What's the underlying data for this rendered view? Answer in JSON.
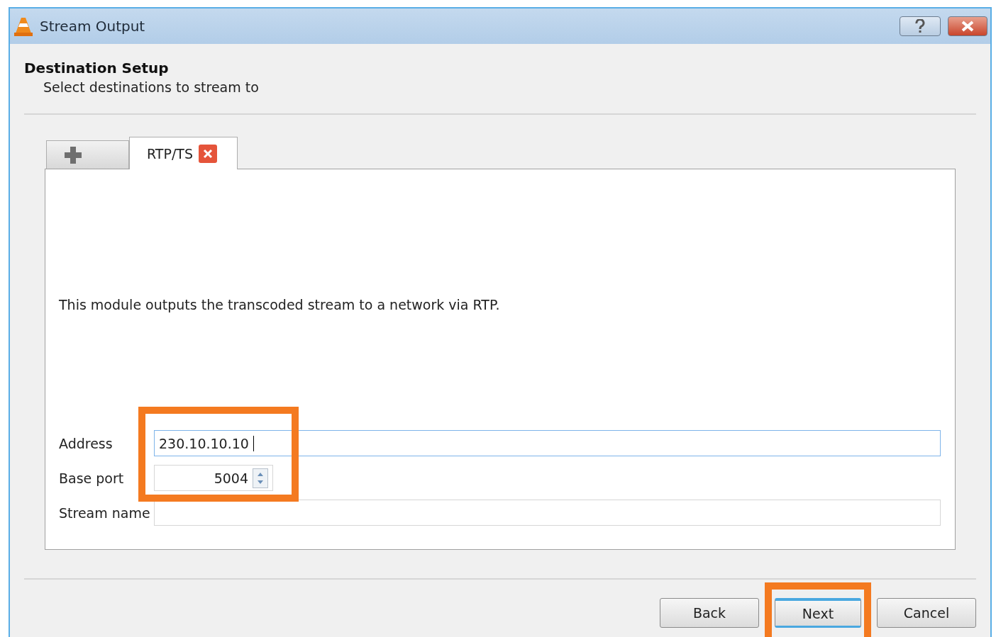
{
  "window": {
    "title": "Stream Output"
  },
  "header": {
    "title": "Destination Setup",
    "subtitle": "Select destinations to stream to"
  },
  "tabs": [
    {
      "kind": "add",
      "selected": false
    },
    {
      "kind": "module",
      "label": "RTP/TS",
      "selected": true
    }
  ],
  "description": "This module outputs the transcoded stream to a network via RTP.",
  "form": {
    "highlighted": true,
    "fields": [
      {
        "kind": "text",
        "label": "Address",
        "value": "230.10.10.10",
        "focused": true
      },
      {
        "kind": "spin",
        "label": "Base port",
        "value": "5004",
        "focused": false
      },
      {
        "kind": "text",
        "label": "Stream name",
        "focused": false
      }
    ]
  },
  "buttons": [
    {
      "label": "Back",
      "default": false,
      "highlighted": false
    },
    {
      "label": "Next",
      "default": true,
      "highlighted": true
    },
    {
      "label": "Cancel",
      "default": false,
      "highlighted": false
    }
  ]
}
